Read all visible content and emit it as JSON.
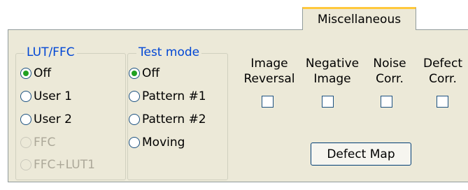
{
  "tabs": {
    "active": "Miscellaneous"
  },
  "lut_ffc": {
    "title": "LUT/FFC",
    "options": [
      {
        "label": "Off",
        "selected": true,
        "enabled": true
      },
      {
        "label": "User 1",
        "selected": false,
        "enabled": true
      },
      {
        "label": "User 2",
        "selected": false,
        "enabled": true
      },
      {
        "label": "FFC",
        "selected": false,
        "enabled": false
      },
      {
        "label": "FFC+LUT1",
        "selected": false,
        "enabled": false
      }
    ]
  },
  "test_mode": {
    "title": "Test mode",
    "options": [
      {
        "label": "Off",
        "selected": true,
        "enabled": true
      },
      {
        "label": "Pattern #1",
        "selected": false,
        "enabled": true
      },
      {
        "label": "Pattern #2",
        "selected": false,
        "enabled": true
      },
      {
        "label": "Moving",
        "selected": false,
        "enabled": true
      }
    ]
  },
  "checkboxes": [
    {
      "line1": "Image",
      "line2": "Reversal",
      "checked": false
    },
    {
      "line1": "Negative",
      "line2": "Image",
      "checked": false
    },
    {
      "line1": "Noise",
      "line2": "Corr.",
      "checked": false
    },
    {
      "line1": "Defect",
      "line2": "Corr.",
      "checked": false
    }
  ],
  "defect_map_button": "Defect Map",
  "colors": {
    "panel": "#ECE9D8",
    "group_title": "#0046D5",
    "tab_accent": "#FFC83C",
    "radio_dot": "#21A121",
    "disabled_text": "#ACA899"
  }
}
